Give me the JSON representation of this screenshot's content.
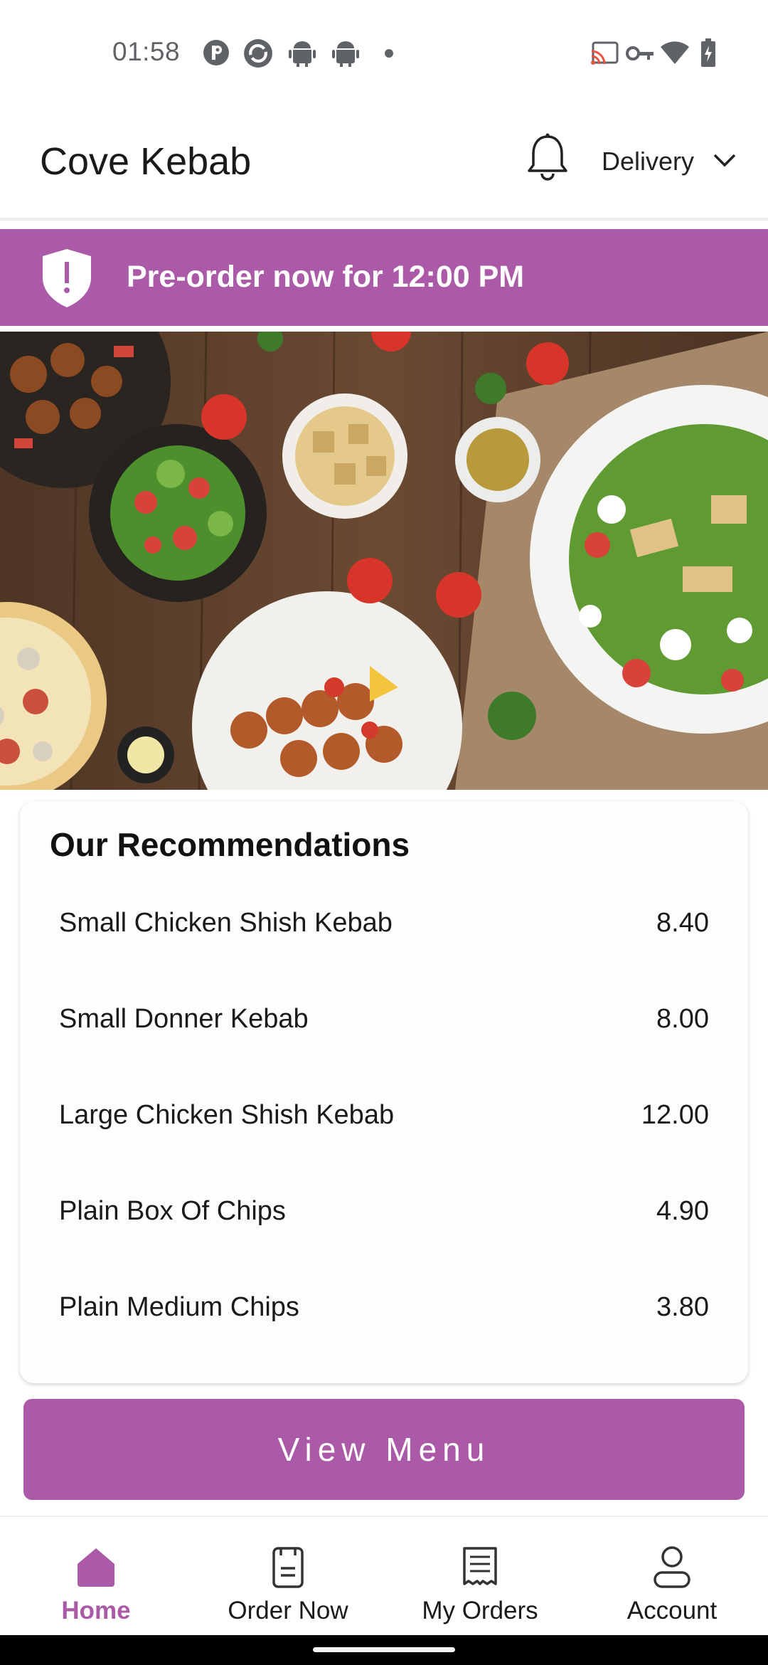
{
  "status_bar": {
    "time": "01:58",
    "left_icons": [
      "p-circle-icon",
      "sync-circle-icon",
      "android-icon",
      "android-icon",
      "dot-icon"
    ],
    "right_icons": [
      "cast-icon",
      "vpn-key-icon",
      "wifi-icon",
      "battery-charging-icon"
    ]
  },
  "header": {
    "title": "Cove Kebab",
    "bell_icon": "bell-icon",
    "order_mode": "Delivery",
    "chevron_icon": "chevron-down-icon"
  },
  "banner": {
    "text": "Pre-order now for 12:00 PM",
    "icon": "shield-alert-icon",
    "color": "#ab5aa7"
  },
  "hero": {
    "image": "food-spread-photo"
  },
  "recommendations": {
    "title": "Our Recommendations",
    "items": [
      {
        "name": "Small Chicken Shish Kebab",
        "price": "8.40"
      },
      {
        "name": "Small Donner Kebab",
        "price": "8.00"
      },
      {
        "name": "Large Chicken Shish Kebab",
        "price": "12.00"
      },
      {
        "name": "Plain Box Of Chips",
        "price": "4.90"
      },
      {
        "name": "Plain Medium Chips",
        "price": "3.80"
      }
    ]
  },
  "view_menu_label": "View Menu",
  "bottom_nav": {
    "items": [
      {
        "label": "Home",
        "icon": "home-icon",
        "active": true
      },
      {
        "label": "Order Now",
        "icon": "menu-card-icon",
        "active": false
      },
      {
        "label": "My Orders",
        "icon": "receipt-icon",
        "active": false
      },
      {
        "label": "Account",
        "icon": "person-icon",
        "active": false
      }
    ]
  },
  "colors": {
    "accent": "#ab5aa7",
    "text": "#1a1a1a"
  }
}
